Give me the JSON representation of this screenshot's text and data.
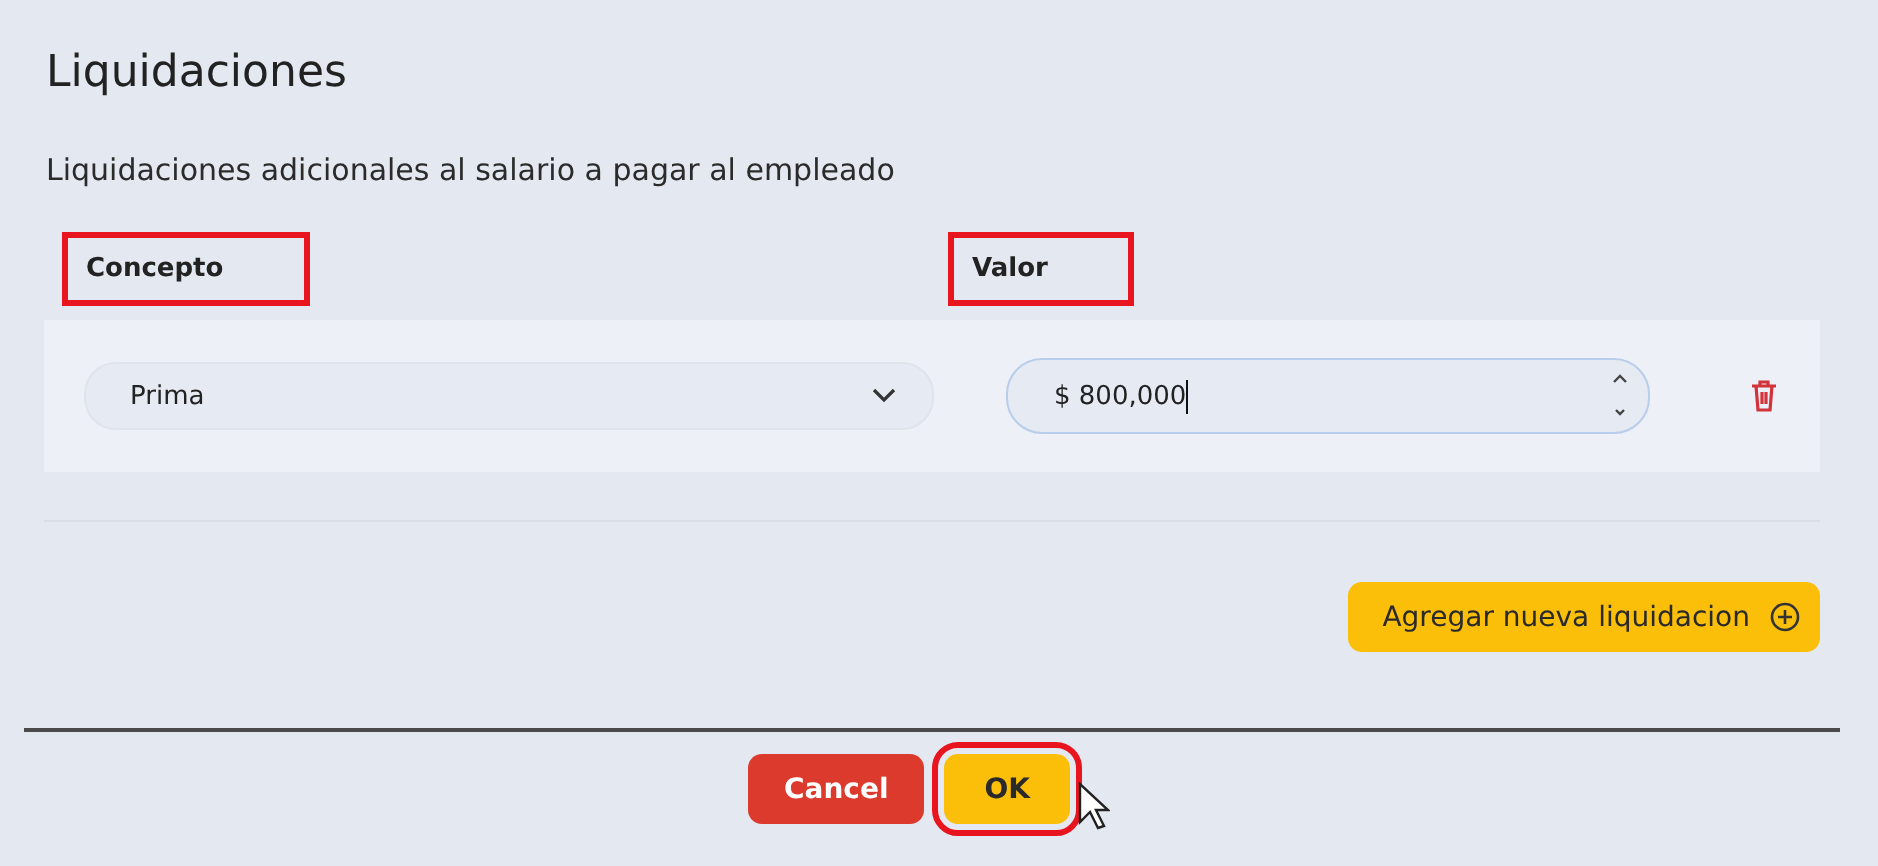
{
  "title": "Liquidaciones",
  "subtitle": "Liquidaciones adicionales al salario a pagar al empleado",
  "columns": [
    {
      "label": "Concepto",
      "highlighted": true
    },
    {
      "label": "Valor",
      "highlighted": true
    }
  ],
  "rows": [
    {
      "concept": "Prima",
      "value": "$ 800,000",
      "focused": true
    }
  ],
  "add_button": {
    "label": "Agregar nueva liquidacion",
    "highlighted": false
  },
  "footer": [
    {
      "label": "Cancel",
      "kind": "danger",
      "highlighted": false
    },
    {
      "label": "OK",
      "kind": "primary",
      "highlighted": true
    }
  ]
}
